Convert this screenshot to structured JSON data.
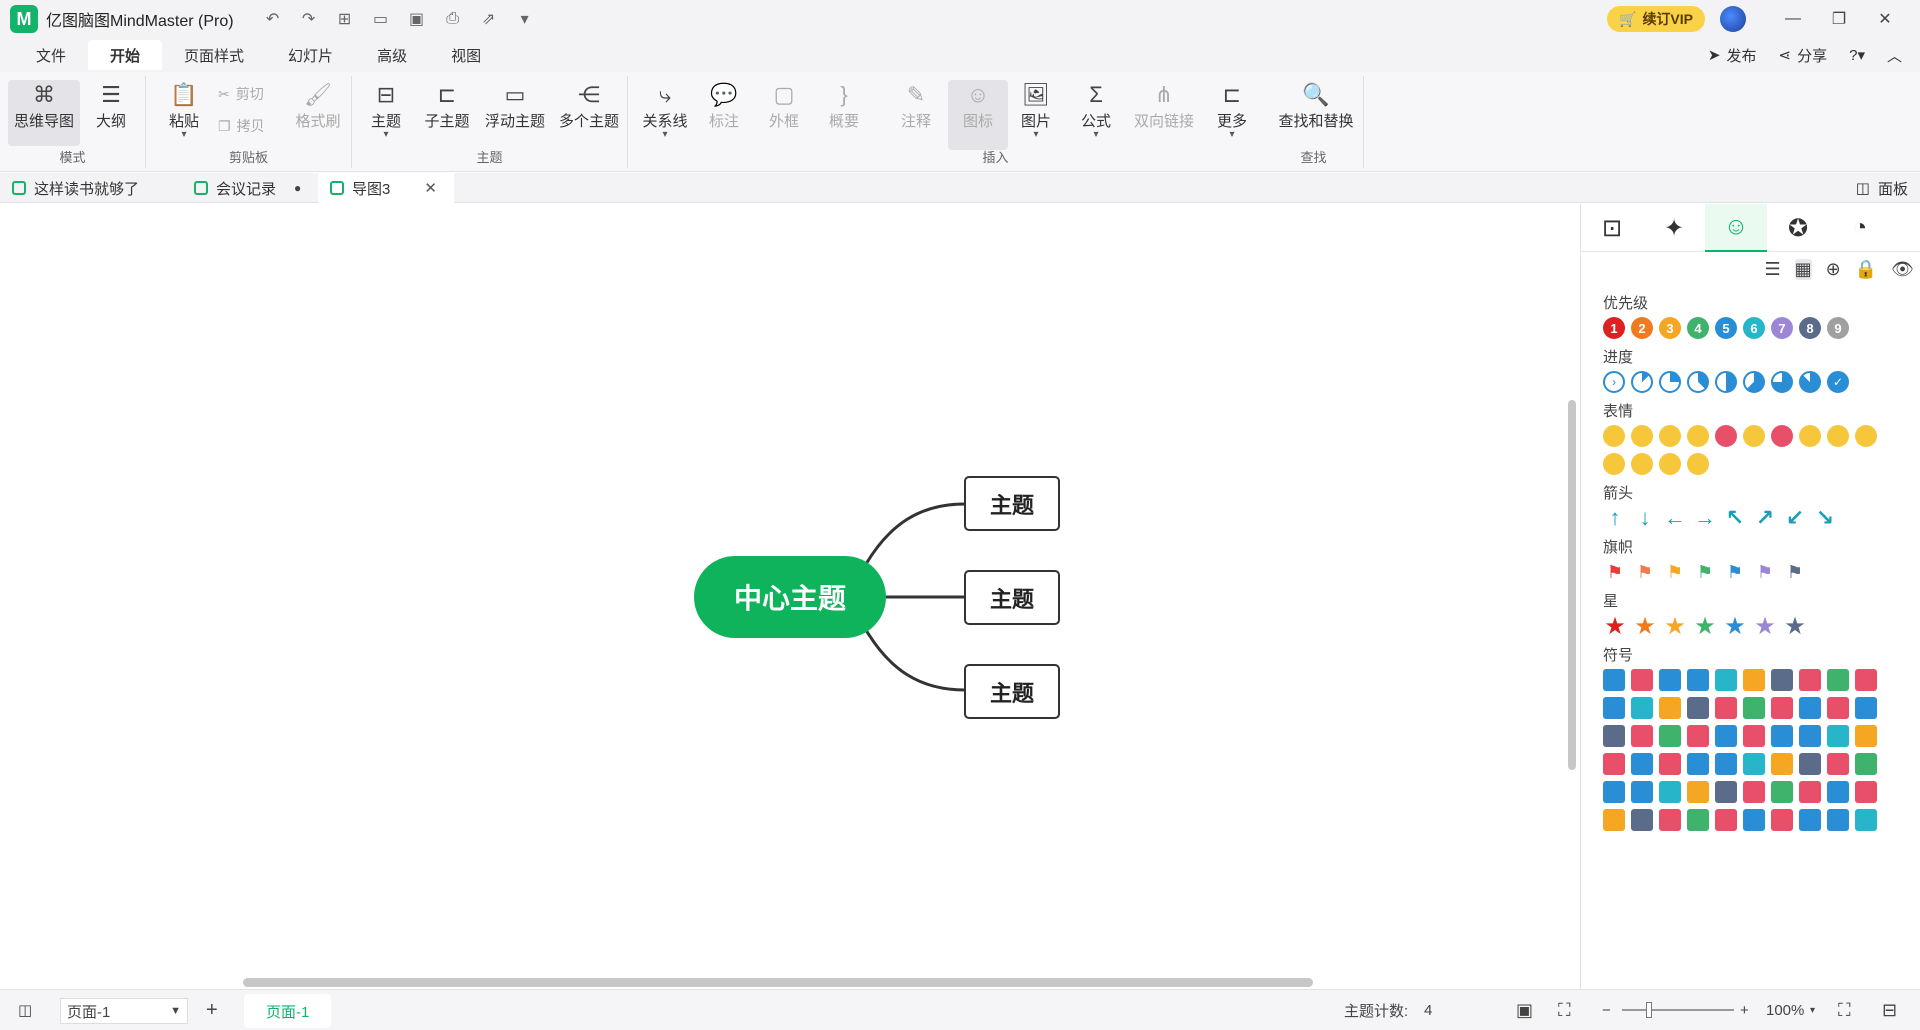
{
  "app": {
    "logo_text": "M",
    "title": "亿图脑图MindMaster (Pro)",
    "vip_label": "续订VIP"
  },
  "menu": {
    "items": [
      "文件",
      "开始",
      "页面样式",
      "幻灯片",
      "高级",
      "视图"
    ],
    "publish": "发布",
    "share": "分享"
  },
  "ribbon": {
    "mode": {
      "mindmap": "思维导图",
      "outline": "大纲",
      "group": "模式"
    },
    "clipboard": {
      "paste": "粘贴",
      "cut": "剪切",
      "copy": "拷贝",
      "format_brush": "格式刷",
      "group": "剪贴板"
    },
    "topic": {
      "topic": "主题",
      "subtopic": "子主题",
      "floating": "浮动主题",
      "multi": "多个主题",
      "group": "主题"
    },
    "insert": {
      "relation": "关系线",
      "callout": "标注",
      "boundary": "外框",
      "summary": "概要",
      "note": "注释",
      "icon": "图标",
      "image": "图片",
      "formula": "公式",
      "bilink": "双向链接",
      "more": "更多",
      "group": "插入"
    },
    "find": {
      "find_replace": "查找和替换",
      "group": "查找"
    }
  },
  "doc_tabs": [
    {
      "label": "这样读书就够了"
    },
    {
      "label": "会议记录"
    },
    {
      "label": "导图3"
    }
  ],
  "panel_toggle": "面板",
  "mindmap": {
    "central": "中心主题",
    "topics": [
      "主题",
      "主题",
      "主题"
    ]
  },
  "panel": {
    "sections": {
      "priority": "优先级",
      "progress": "进度",
      "emotion": "表情",
      "arrow": "箭头",
      "flag": "旗帜",
      "star": "星",
      "symbol": "符号"
    },
    "priority_numbers": [
      "1",
      "2",
      "3",
      "4",
      "5",
      "6",
      "7",
      "8",
      "9"
    ],
    "priority_colors": [
      "#e02020",
      "#f07b1f",
      "#f5a623",
      "#3fb36b",
      "#2a8ed6",
      "#27b6c9",
      "#9b87d6",
      "#5b6b8a",
      "#a0a0a0"
    ],
    "arrows": [
      "↑",
      "↓",
      "←",
      "→",
      "↖",
      "↗",
      "↙",
      "↘"
    ],
    "flag_colors": [
      "#e83a3a",
      "#f07b4a",
      "#f5a623",
      "#3fb36b",
      "#2a8ed6",
      "#9b87d6",
      "#5b6b8a"
    ],
    "star_colors": [
      "#e02020",
      "#f07b1f",
      "#f5a623",
      "#3fb36b",
      "#2a8ed6",
      "#9b87d6",
      "#5b6b8a"
    ],
    "symbol_colors": [
      "#2a8ed6",
      "#e8506a",
      "#2a8ed6",
      "#2a8ed6",
      "#27b6c9",
      "#f5a623",
      "#5b6b8a",
      "#e8506a",
      "#3fb36b",
      "#e8506a"
    ]
  },
  "statusbar": {
    "page_select": "页面-1",
    "page_tab": "页面-1",
    "topic_count_label": "主题计数:",
    "topic_count": "4",
    "zoom": "100%"
  }
}
